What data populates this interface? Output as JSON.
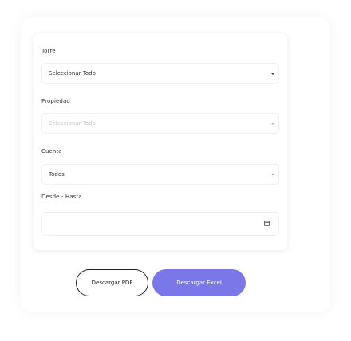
{
  "form": {
    "torre": {
      "label": "Torre",
      "value": "Seleccionar Todo"
    },
    "propiedad": {
      "label": "Propiedad",
      "placeholder": "Seleccionar Todo"
    },
    "cuenta": {
      "label": "Cuenta",
      "value": "Todos"
    },
    "fechas": {
      "label": "Desde - Hasta",
      "value": ""
    }
  },
  "actions": {
    "pdf_label": "Descargar PDF",
    "excel_label": "Descargar Excel"
  },
  "icons": {
    "dropdown": "chevron-down-icon",
    "date": "calendar-icon"
  },
  "colors": {
    "primary_button": "#7a78e8"
  }
}
